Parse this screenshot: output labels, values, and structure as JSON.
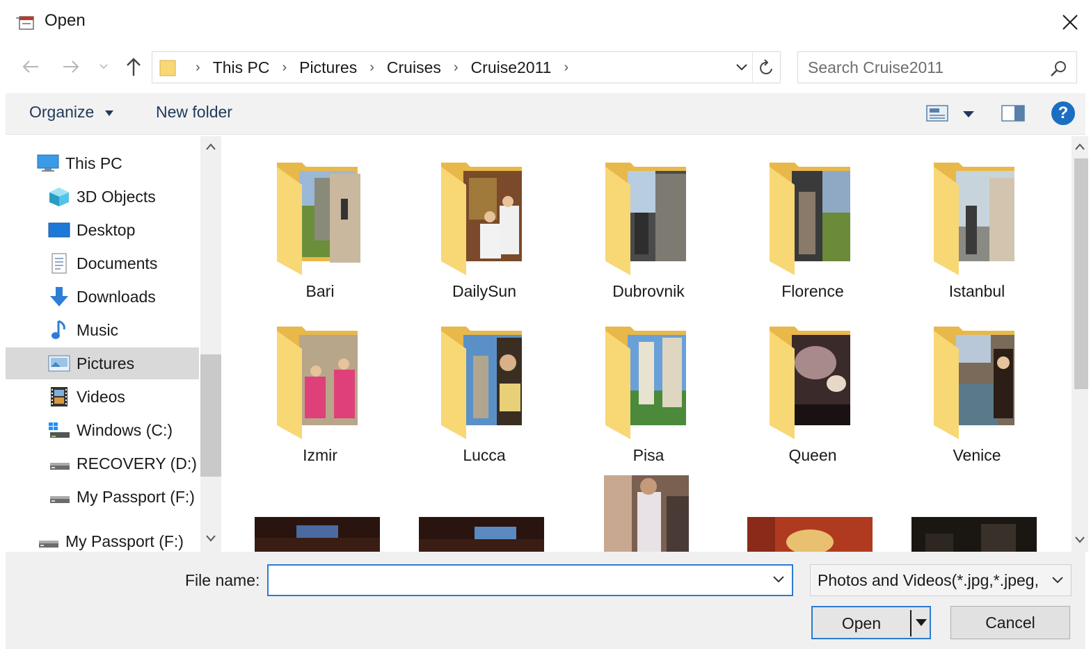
{
  "window": {
    "title": "Open"
  },
  "address": {
    "crumbs": [
      "This PC",
      "Pictures",
      "Cruises",
      "Cruise2011"
    ],
    "search_placeholder": "Search Cruise2011"
  },
  "toolbar": {
    "organize": "Organize",
    "new_folder": "New folder",
    "help": "?"
  },
  "sidebar": {
    "items": [
      {
        "label": "This PC",
        "icon": "monitor-icon"
      },
      {
        "label": "3D Objects",
        "icon": "cube-icon"
      },
      {
        "label": "Desktop",
        "icon": "desktop-icon"
      },
      {
        "label": "Documents",
        "icon": "document-icon"
      },
      {
        "label": "Downloads",
        "icon": "download-arrow-icon"
      },
      {
        "label": "Music",
        "icon": "music-note-icon"
      },
      {
        "label": "Pictures",
        "icon": "pictures-icon",
        "selected": true
      },
      {
        "label": "Videos",
        "icon": "film-icon"
      },
      {
        "label": "Windows (C:)",
        "icon": "windows-drive-icon"
      },
      {
        "label": "RECOVERY (D:)",
        "icon": "drive-icon"
      },
      {
        "label": "My Passport (F:)",
        "icon": "drive-icon"
      },
      {
        "label": "My Passport (F:)",
        "icon": "drive-icon"
      }
    ]
  },
  "folders": [
    {
      "name": "Bari"
    },
    {
      "name": "DailySun"
    },
    {
      "name": "Dubrovnik"
    },
    {
      "name": "Florence"
    },
    {
      "name": "Istanbul"
    },
    {
      "name": "Izmir"
    },
    {
      "name": "Lucca"
    },
    {
      "name": "Pisa"
    },
    {
      "name": "Queen"
    },
    {
      "name": "Venice"
    }
  ],
  "bottom": {
    "file_name_label": "File name:",
    "file_name_value": "",
    "file_type": "Photos and Videos(*.jpg,*.jpeg,",
    "open": "Open",
    "cancel": "Cancel"
  },
  "colors": {
    "accent": "#2b7bd1",
    "selected_bg": "#d9d9d9",
    "folder": "#f8d775",
    "toolbar_text": "#1e395b"
  }
}
